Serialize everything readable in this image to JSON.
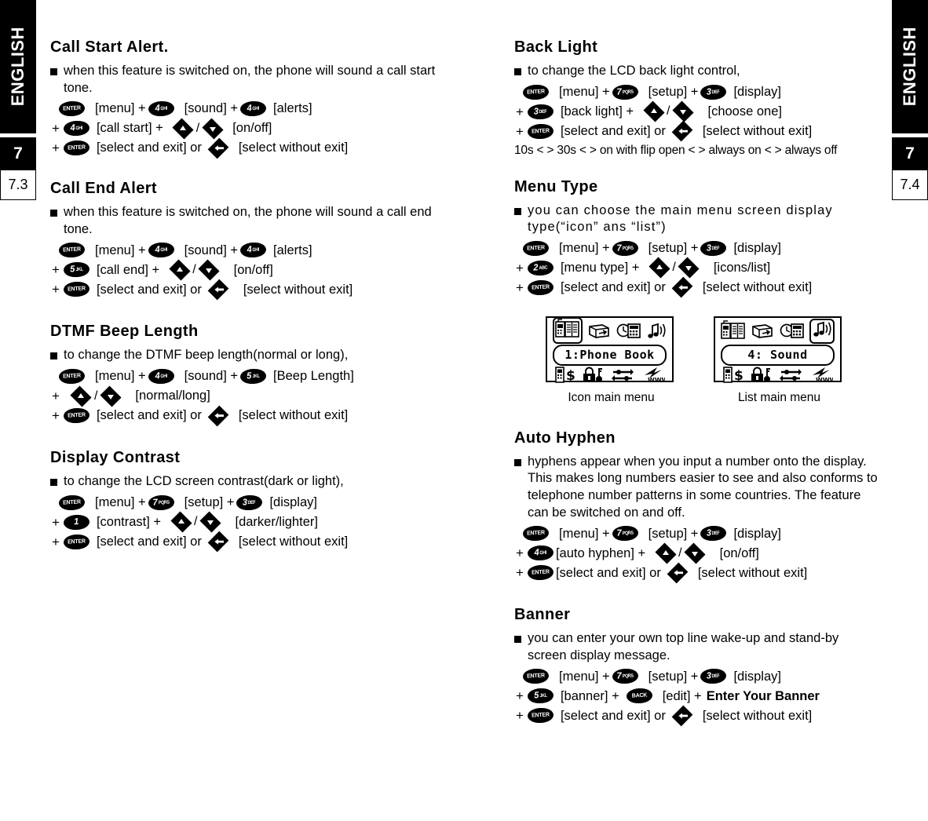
{
  "side_tabs": {
    "left": {
      "language": "ENGLISH",
      "chapter": "7",
      "section": "7.3"
    },
    "right": {
      "language": "ENGLISH",
      "chapter": "7",
      "section": "7.4"
    }
  },
  "labels": {
    "plus": "+",
    "slash": "/",
    "or": "or"
  },
  "keys": {
    "enter": "ENTER",
    "back": "BACK",
    "n1_big": "1",
    "n1_sml": "",
    "n2_big": "2",
    "n2_sml": "ABC",
    "n3_big": "3",
    "n3_sml": "DEF",
    "n4_big": "4",
    "n4_sml": "GHI",
    "n5_big": "5",
    "n5_sml": "JKL",
    "n7_big": "7",
    "n7_sml": "PQRS"
  },
  "left_column": {
    "sections": [
      {
        "title": "Call Start Alert.",
        "bullet": "when this feature is switched on, the phone will sound a call start tone.",
        "steps": [
          {
            "parts": [
              "[menu] +",
              "[sound] +",
              "[alerts]"
            ]
          },
          {
            "parts": [
              "[call start] +",
              "[on/off]"
            ]
          },
          {
            "parts": [
              "[select and exit] or",
              "[select without exit]"
            ]
          }
        ]
      },
      {
        "title": "Call End Alert",
        "bullet": "when this feature is switched on, the phone will sound a call end tone.",
        "steps": [
          {
            "parts": [
              "[menu] +",
              "[sound] +",
              "[alerts]"
            ]
          },
          {
            "parts": [
              "[call end] +",
              "[on/off]"
            ]
          },
          {
            "parts": [
              "[select and exit] or",
              "[select without exit]"
            ]
          }
        ]
      },
      {
        "title": "DTMF Beep Length",
        "bullet": "to change the DTMF beep length(normal or long),",
        "steps": [
          {
            "parts": [
              "[menu] +",
              "[sound] +",
              "[Beep Length]"
            ]
          },
          {
            "parts": [
              "[normal/long]"
            ]
          },
          {
            "parts": [
              "[select and exit] or",
              "[select without exit]"
            ]
          }
        ]
      },
      {
        "title": "Display Contrast",
        "bullet": "to change the LCD screen contrast(dark or light),",
        "steps": [
          {
            "parts": [
              "[menu] +",
              "[setup] +",
              "[display]"
            ]
          },
          {
            "parts": [
              "[contrast] +",
              "[darker/lighter]"
            ]
          },
          {
            "parts": [
              "[select and exit] or",
              "[select without exit]"
            ]
          }
        ]
      }
    ]
  },
  "right_column": {
    "back_light": {
      "title": "Back Light",
      "bullet": "to change the LCD back light control,",
      "l1_a": "[menu] +",
      "l1_b": "[setup] +",
      "l1_c": "[display]",
      "l2_a": "[back light] +",
      "l2_b": "[choose one]",
      "l3_a": "[select and exit] or",
      "l3_b": "[select without exit]",
      "tail": "10s < > 30s < > on with flip open < > always on < > always off"
    },
    "menu_type": {
      "title": "Menu Type",
      "bullet": "you can choose the main menu screen display type(“icon” ans “list”)",
      "l1_a": "[menu] +",
      "l1_b": "[setup] +",
      "l1_c": "[display]",
      "l2_a": "[menu type] +",
      "l2_b": "[icons/list]",
      "l3_a": "[select and exit] or",
      "l3_b": "[select without exit]"
    },
    "figures": [
      {
        "screen_text": "1:Phone  Book",
        "caption": "Icon main menu",
        "highlight": "first"
      },
      {
        "screen_text": "4: Sound",
        "caption": "List main menu",
        "highlight": "fourth"
      }
    ],
    "auto_hyphen": {
      "title": "Auto Hyphen",
      "bullet": "hyphens appear when you input a number onto the display. This makes long numbers easier to see and also conforms to telephone number patterns in some countries. The feature can be switched on and off.",
      "l1_a": "[menu] +",
      "l1_b": "[setup] +",
      "l1_c": "[display]",
      "l2_a": "[auto hyphen] +",
      "l2_b": "[on/off]",
      "l3_a": "[select and exit] or",
      "l3_b": "[select without exit]"
    },
    "banner": {
      "title": "Banner",
      "bullet": "you can enter your own top line wake-up and stand-by screen display message.",
      "l1_a": "[menu] +",
      "l1_b": "[setup] +",
      "l1_c": "[display]",
      "l2_a": "[banner] +",
      "l2_b": "[edit] +",
      "l2_c": "Enter Your Banner",
      "l3_a": "[select and exit] or",
      "l3_b": "[select without exit]"
    }
  }
}
